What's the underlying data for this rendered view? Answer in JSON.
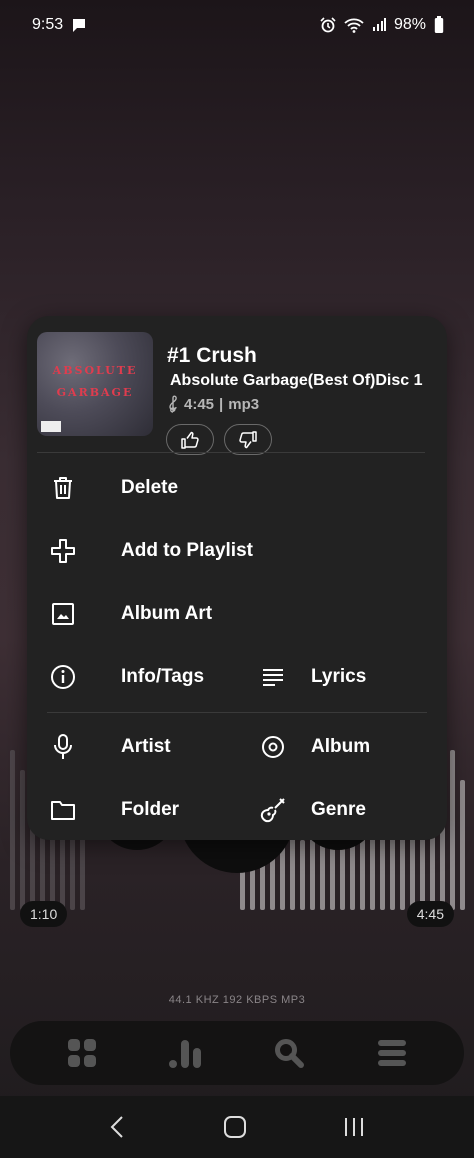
{
  "status_bar": {
    "time": "9:53",
    "battery": "98%"
  },
  "track": {
    "title": "#1 Crush",
    "album": "Absolute Garbage(Best Of)Disc 1",
    "duration": "4:45",
    "format": "mp3",
    "art_text_line1": "ABSOLUTE",
    "art_text_line2": "GARBAGE"
  },
  "menu": {
    "delete": "Delete",
    "add_to_playlist": "Add to Playlist",
    "album_art": "Album Art",
    "info_tags": "Info/Tags",
    "lyrics": "Lyrics",
    "artist": "Artist",
    "album": "Album",
    "folder": "Folder",
    "genre": "Genre"
  },
  "player": {
    "elapsed": "1:10",
    "total": "4:45",
    "format_info": "44.1 KHZ  192 KBPS  MP3"
  },
  "colors": {
    "sheet": "#222222",
    "accent_art_text": "#e03c4e"
  }
}
